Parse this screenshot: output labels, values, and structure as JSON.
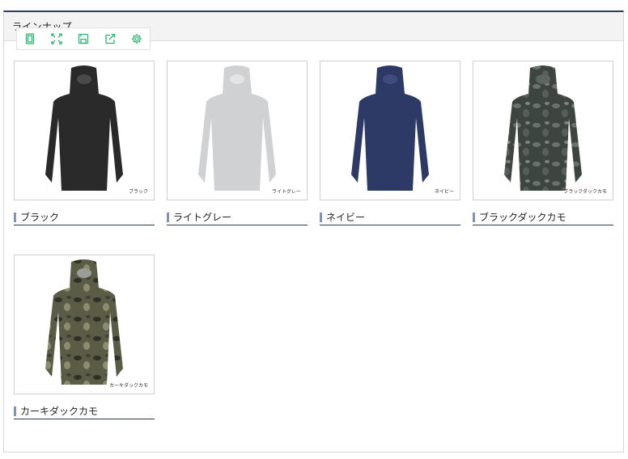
{
  "section": {
    "title": "ラインナップ"
  },
  "toolbar": {
    "tools": [
      {
        "icon": "page-icon"
      },
      {
        "icon": "expand-icon"
      },
      {
        "icon": "save-icon"
      },
      {
        "icon": "share-icon"
      },
      {
        "icon": "gear-icon"
      }
    ],
    "accent": "#2bb673"
  },
  "products": [
    {
      "label": "ブラック",
      "caption": "ブラック",
      "color": "#2a2a2a",
      "pattern": "solid"
    },
    {
      "label": "ライトグレー",
      "caption": "ライトグレー",
      "color": "#cfd1d3",
      "pattern": "solid"
    },
    {
      "label": "ネイビー",
      "caption": "ネイビー",
      "color": "#2e3a66",
      "pattern": "solid"
    },
    {
      "label": "ブラックダックカモ",
      "caption": "ブラックダックカモ",
      "color": "#3d4541",
      "pattern": "camo"
    },
    {
      "label": "カーキダックカモ",
      "caption": "カーキダックカモ",
      "color": "#5a5c45",
      "pattern": "camo"
    }
  ]
}
